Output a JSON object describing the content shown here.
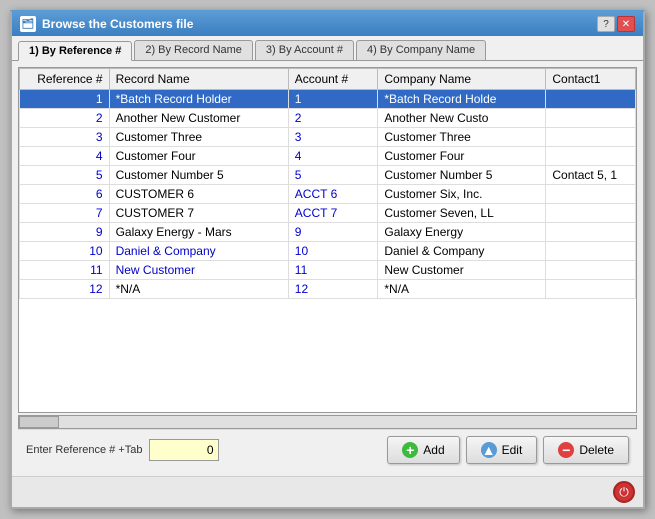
{
  "window": {
    "title": "Browse the Customers file",
    "help_label": "?",
    "close_label": "✕"
  },
  "tabs": [
    {
      "id": "tab1",
      "label": "1) By Reference #",
      "active": true
    },
    {
      "id": "tab2",
      "label": "2) By Record Name",
      "active": false
    },
    {
      "id": "tab3",
      "label": "3) By Account #",
      "active": false
    },
    {
      "id": "tab4",
      "label": "4) By Company Name",
      "active": false
    }
  ],
  "table": {
    "columns": [
      {
        "id": "ref",
        "label": "Reference #"
      },
      {
        "id": "name",
        "label": "Record Name"
      },
      {
        "id": "acct",
        "label": "Account #"
      },
      {
        "id": "company",
        "label": "Company Name"
      },
      {
        "id": "contact",
        "label": "Contact1"
      }
    ],
    "rows": [
      {
        "ref": "1",
        "name": "*Batch Record Holder",
        "acct": "1",
        "company": "*Batch Record Holde",
        "contact": "",
        "selected": true,
        "name_color": "white",
        "acct_color": "white"
      },
      {
        "ref": "2",
        "name": "Another New Customer",
        "acct": "2",
        "company": "Another New Custo",
        "contact": "",
        "selected": false,
        "name_color": "black",
        "acct_color": "blue"
      },
      {
        "ref": "3",
        "name": "Customer Three",
        "acct": "3",
        "company": "Customer Three",
        "contact": "",
        "selected": false,
        "name_color": "black",
        "acct_color": "blue"
      },
      {
        "ref": "4",
        "name": "Customer Four",
        "acct": "4",
        "company": "Customer Four",
        "contact": "",
        "selected": false,
        "name_color": "black",
        "acct_color": "blue"
      },
      {
        "ref": "5",
        "name": "Customer Number 5",
        "acct": "5",
        "company": "Customer Number 5",
        "contact": "Contact 5, 1",
        "selected": false,
        "name_color": "black",
        "acct_color": "blue"
      },
      {
        "ref": "6",
        "name": "CUSTOMER 6",
        "acct": "ACCT 6",
        "company": "Customer Six, Inc.",
        "contact": "",
        "selected": false,
        "name_color": "black",
        "acct_color": "blue"
      },
      {
        "ref": "7",
        "name": "CUSTOMER 7",
        "acct": "ACCT 7",
        "company": "Customer Seven, LL",
        "contact": "",
        "selected": false,
        "name_color": "black",
        "acct_color": "blue"
      },
      {
        "ref": "9",
        "name": "Galaxy Energy - Mars",
        "acct": "9",
        "company": "Galaxy Energy",
        "contact": "",
        "selected": false,
        "name_color": "black",
        "acct_color": "blue"
      },
      {
        "ref": "10",
        "name": "Daniel & Company",
        "acct": "10",
        "company": "Daniel & Company",
        "contact": "",
        "selected": false,
        "name_color": "blue",
        "acct_color": "blue"
      },
      {
        "ref": "11",
        "name": "New Customer",
        "acct": "11",
        "company": "New Customer",
        "contact": "",
        "selected": false,
        "name_color": "blue",
        "acct_color": "blue"
      },
      {
        "ref": "12",
        "name": "*N/A",
        "acct": "12",
        "company": "*N/A",
        "contact": "",
        "selected": false,
        "name_color": "black",
        "acct_color": "blue"
      }
    ]
  },
  "bottom": {
    "input_label": "Enter Reference # +Tab",
    "input_value": "0"
  },
  "buttons": {
    "add_label": "Add",
    "edit_label": "Edit",
    "delete_label": "Delete"
  }
}
